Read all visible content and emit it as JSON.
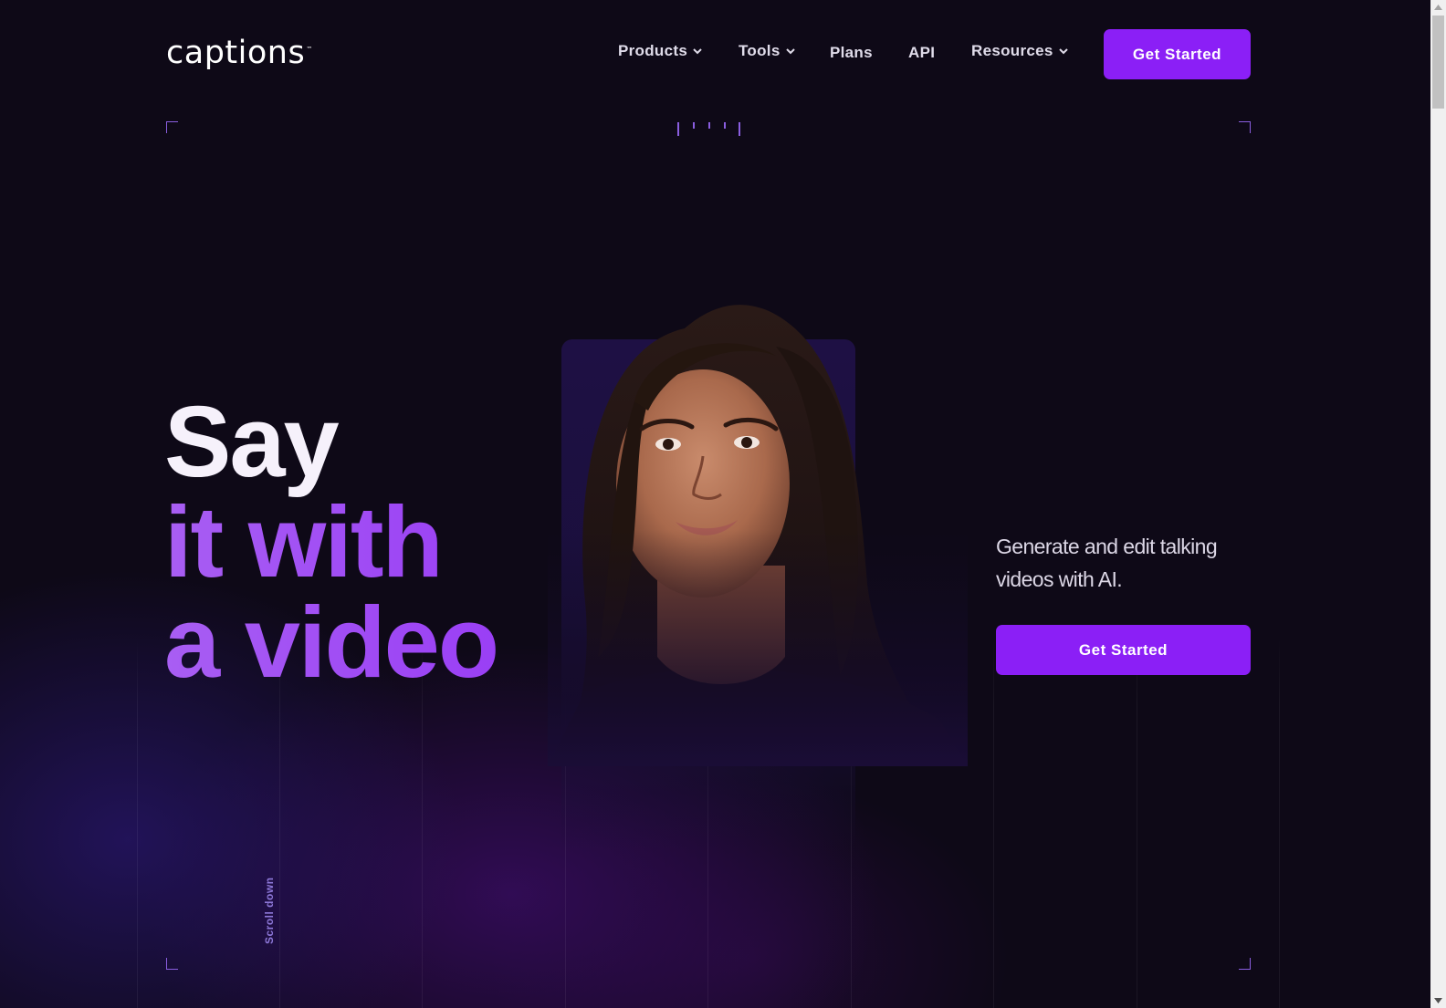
{
  "brand": {
    "logo_text": "captions",
    "trademark": "™"
  },
  "nav": {
    "items": [
      {
        "label": "Products",
        "has_dropdown": true
      },
      {
        "label": "Tools",
        "has_dropdown": true
      },
      {
        "label": "Plans",
        "has_dropdown": false
      },
      {
        "label": "API",
        "has_dropdown": false
      },
      {
        "label": "Resources",
        "has_dropdown": true
      }
    ],
    "cta_label": "Get Started"
  },
  "hero": {
    "headline_line1": "Say",
    "headline_line2": "it with",
    "headline_line3": "a video",
    "subcopy": "Generate and edit talking videos with AI.",
    "cta_label": "Get Started",
    "scroll_hint": "Scroll down",
    "portrait_alt": "Woman smiling, AI talking video presenter"
  },
  "colors": {
    "accent": "#8b1ff6",
    "headline_purple": "#a254f4",
    "background": "#0e0917",
    "corner_marks": "#8a5ee0"
  }
}
